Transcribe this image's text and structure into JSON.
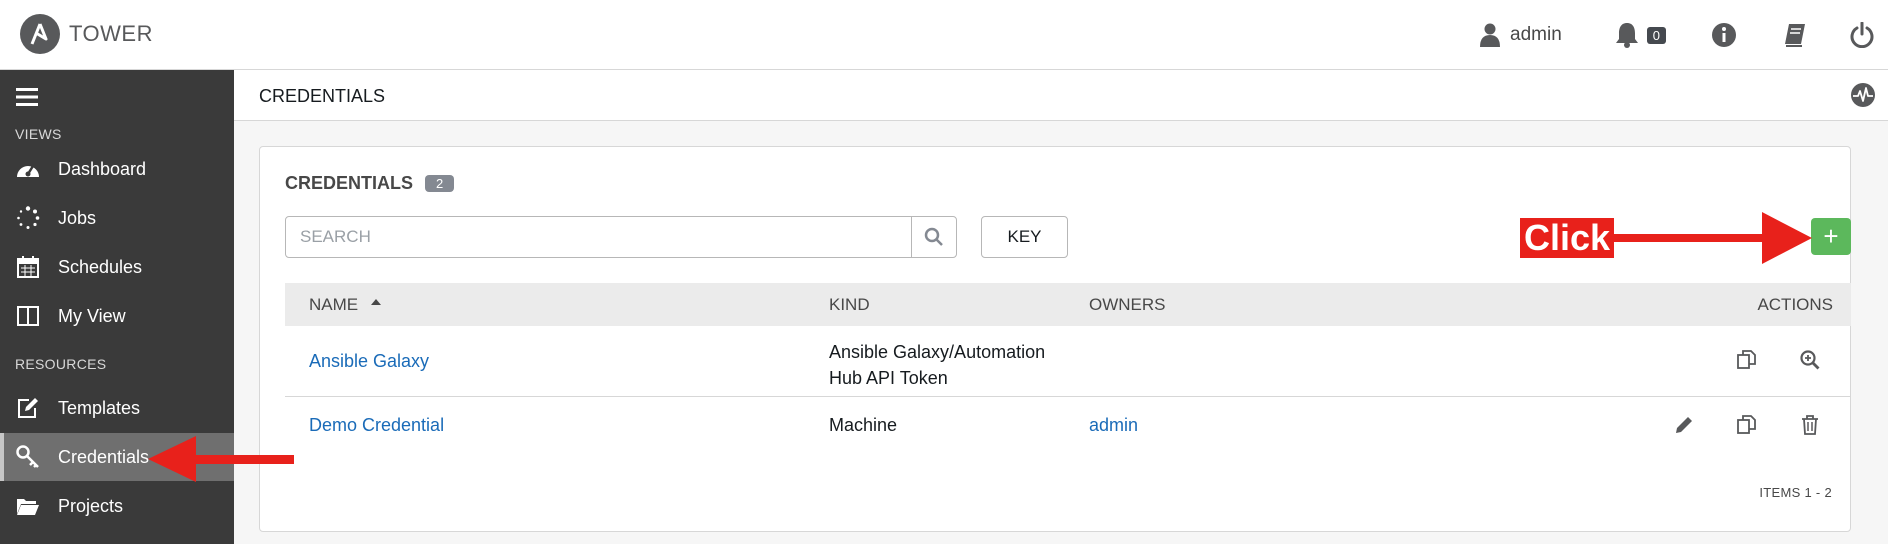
{
  "app": {
    "brand": "TOWER"
  },
  "topnav": {
    "user": "admin",
    "notification_count": "0"
  },
  "sidebar": {
    "sections": [
      "VIEWS",
      "RESOURCES"
    ],
    "items": [
      {
        "label": "Dashboard",
        "icon": "dashboard-icon"
      },
      {
        "label": "Jobs",
        "icon": "spinner-icon"
      },
      {
        "label": "Schedules",
        "icon": "calendar-icon"
      },
      {
        "label": "My View",
        "icon": "columns-icon"
      },
      {
        "label": "Templates",
        "icon": "edit-icon"
      },
      {
        "label": "Credentials",
        "icon": "key-icon",
        "active": true
      },
      {
        "label": "Projects",
        "icon": "folder-open-icon"
      }
    ]
  },
  "breadcrumb": "CREDENTIALS",
  "panel": {
    "title": "CREDENTIALS",
    "count": "2",
    "search_placeholder": "SEARCH",
    "key_label": "KEY",
    "add_label": "+"
  },
  "table": {
    "columns": [
      "NAME",
      "KIND",
      "OWNERS",
      "ACTIONS"
    ],
    "rows": [
      {
        "name": "Ansible Galaxy",
        "kind_line1": "Ansible Galaxy/Automation",
        "kind_line2": "Hub API Token",
        "owner": ""
      },
      {
        "name": "Demo Credential",
        "kind_line1": "Machine",
        "kind_line2": "",
        "owner": "admin"
      }
    ],
    "items_label": "ITEMS  1 - 2"
  },
  "annotations": {
    "click_label": "Click",
    "color": "#e8211b"
  },
  "colors": {
    "sidebar": "#3a3a3a",
    "add_button": "#5cb85c",
    "link": "#1a6bb8"
  }
}
